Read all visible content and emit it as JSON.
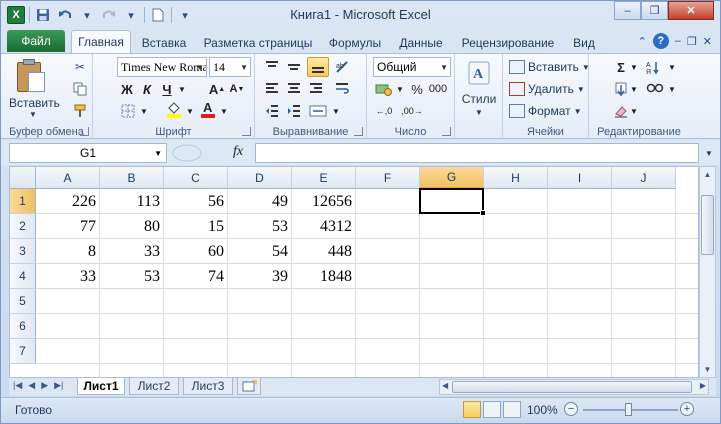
{
  "window": {
    "title": "Книга1  -  Microsoft Excel",
    "app_icon_letter": "X",
    "controls": [
      "–",
      "❐",
      "✕"
    ]
  },
  "qat": {
    "save_icon": "save-icon",
    "undo_icon": "undo-icon",
    "redo_icon": "redo-icon"
  },
  "ribbon_tabs": {
    "file": "Файл",
    "items": [
      "Главная",
      "Вставка",
      "Разметка страницы",
      "Формулы",
      "Данные",
      "Рецензирование",
      "Вид"
    ],
    "active": "Главная"
  },
  "ribbon": {
    "clipboard": {
      "label": "Буфер обмена",
      "paste": "Вставить"
    },
    "font": {
      "label": "Шрифт",
      "font_name": "Times New Roman",
      "font_size": "14",
      "bold": "Ж",
      "italic": "К",
      "underline": "Ч",
      "font_color": "#e02020",
      "fill_color": "#ffff00"
    },
    "alignment": {
      "label": "Выравнивание"
    },
    "number": {
      "label": "Число",
      "format": "Общий",
      "percent": "%",
      "thousands": "000"
    },
    "styles": {
      "label": "Стили"
    },
    "cells": {
      "label": "Ячейки",
      "insert": "Вставить",
      "delete": "Удалить",
      "format": "Формат"
    },
    "editing": {
      "label": "Редактирование",
      "sum": "Σ"
    }
  },
  "formula_bar": {
    "name_box": "G1",
    "fx": "fx",
    "formula": ""
  },
  "sheet": {
    "columns": [
      "A",
      "B",
      "C",
      "D",
      "E",
      "F",
      "G",
      "H",
      "I",
      "J"
    ],
    "selected_column": "G",
    "rows": [
      "1",
      "2",
      "3",
      "4",
      "5",
      "6",
      "7"
    ],
    "selected_row": "1",
    "data": [
      [
        "226",
        "113",
        "56",
        "49",
        "12656"
      ],
      [
        "77",
        "80",
        "15",
        "53",
        "4312"
      ],
      [
        "8",
        "33",
        "60",
        "54",
        "448"
      ],
      [
        "33",
        "53",
        "74",
        "39",
        "1848"
      ]
    ],
    "active_cell": "G1"
  },
  "sheet_tabs": {
    "items": [
      "Лист1",
      "Лист2",
      "Лист3"
    ],
    "active": "Лист1"
  },
  "status": {
    "text": "Готово",
    "zoom": "100%"
  }
}
